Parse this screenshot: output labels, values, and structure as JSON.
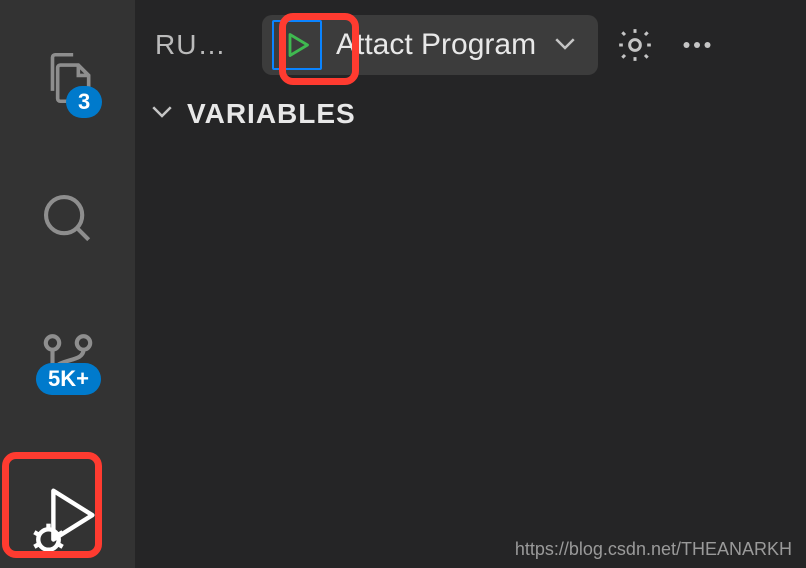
{
  "activity": {
    "files_badge": "3",
    "scm_badge": "5K+"
  },
  "panel": {
    "title": "RU…",
    "config_name": "Attact Program",
    "section_variables": "VARIABLES"
  },
  "watermark": "https://blog.csdn.net/THEANARKH"
}
